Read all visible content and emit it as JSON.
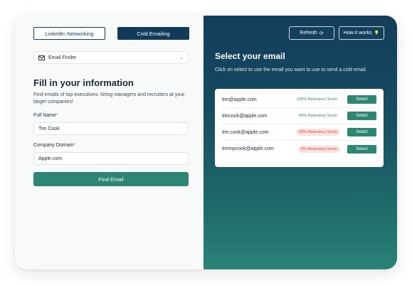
{
  "tabs": {
    "linkedin": "LinkedIn Networking",
    "cold": "Cold Emailing"
  },
  "finder": {
    "label": "Email Finder",
    "chevron": "⌄"
  },
  "form": {
    "heading": "Fill in your information",
    "description": "Find emails of top executives, hiring managers and recruiters at your target companies!",
    "name_label": "Full Name",
    "name_value": "Tim Cook",
    "domain_label": "Company Domain",
    "domain_value": "Apple.com",
    "required_mark": "*",
    "submit": "Find Email"
  },
  "right": {
    "refresh": "Refresh",
    "refresh_icon": "⟳",
    "how": "How it works",
    "how_icon": "💡",
    "title": "Select your email",
    "description": "Click on select to use the email you want to use to send a cold email.",
    "select_label": "Select",
    "results": [
      {
        "email": "tim@apple.com",
        "score": "100% Relevancy Score",
        "status": "good"
      },
      {
        "email": "timcook@apple.com",
        "score": "90% Relevancy Score",
        "status": "good"
      },
      {
        "email": "tim.cook@apple.com",
        "score": "50% Relevancy Score",
        "status": "bad"
      },
      {
        "email": "timmycook@apple.com",
        "score": "5% Relevancy Score",
        "status": "bad"
      }
    ]
  },
  "colors": {
    "navy": "#123b5a",
    "teal": "#2f8574",
    "alert": "#d9443a"
  }
}
